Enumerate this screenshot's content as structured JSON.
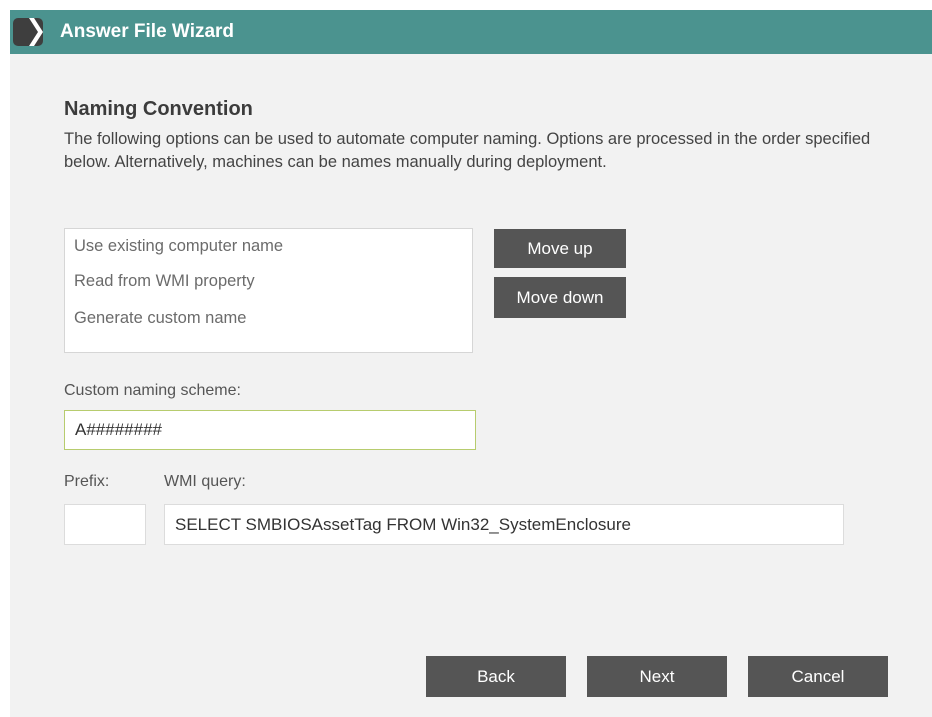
{
  "window": {
    "title": "Answer File Wizard"
  },
  "page": {
    "heading": "Naming Convention",
    "description": "The following options can be used to automate computer naming. Options are processed in the order specified below. Alternatively, machines can be names manually during deployment."
  },
  "naming_options": {
    "items": [
      {
        "label": "Use existing computer name"
      },
      {
        "label": "Read from WMI property"
      },
      {
        "label": "Generate custom name"
      }
    ],
    "move_up_label": "Move up",
    "move_down_label": "Move down"
  },
  "custom_scheme": {
    "label": "Custom naming scheme:",
    "value": "A########"
  },
  "prefix": {
    "label": "Prefix:",
    "value": ""
  },
  "wmi_query": {
    "label": "WMI query:",
    "value": "SELECT SMBIOSAssetTag FROM Win32_SystemEnclosure"
  },
  "footer": {
    "back_label": "Back",
    "next_label": "Next",
    "cancel_label": "Cancel"
  },
  "colors": {
    "titlebar": "#4b938f",
    "button": "#555555",
    "focus_border": "#b7cc6e",
    "window_background": "#f2f2f2"
  }
}
